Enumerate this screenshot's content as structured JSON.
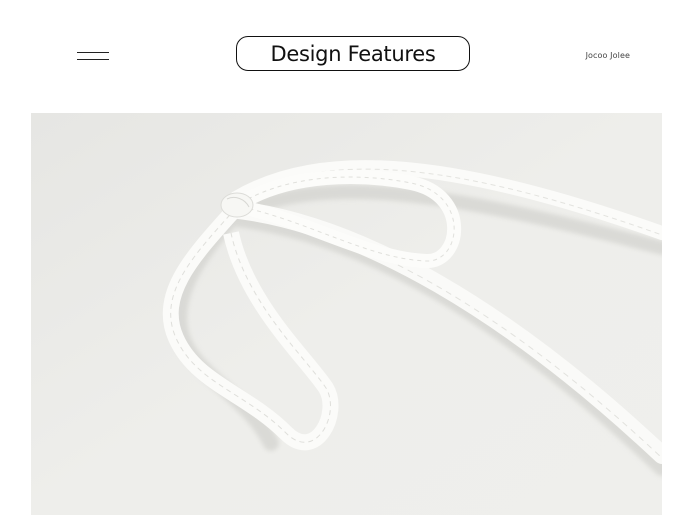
{
  "header": {
    "menu_icon": "hamburger-menu-icon",
    "title": "Design Features",
    "brand": "Jocoo Jolee"
  },
  "photo": {
    "subject": "white-strap-bow-detail-image",
    "background_color": "#ecece9",
    "strap_color": "#fbfbf9"
  }
}
